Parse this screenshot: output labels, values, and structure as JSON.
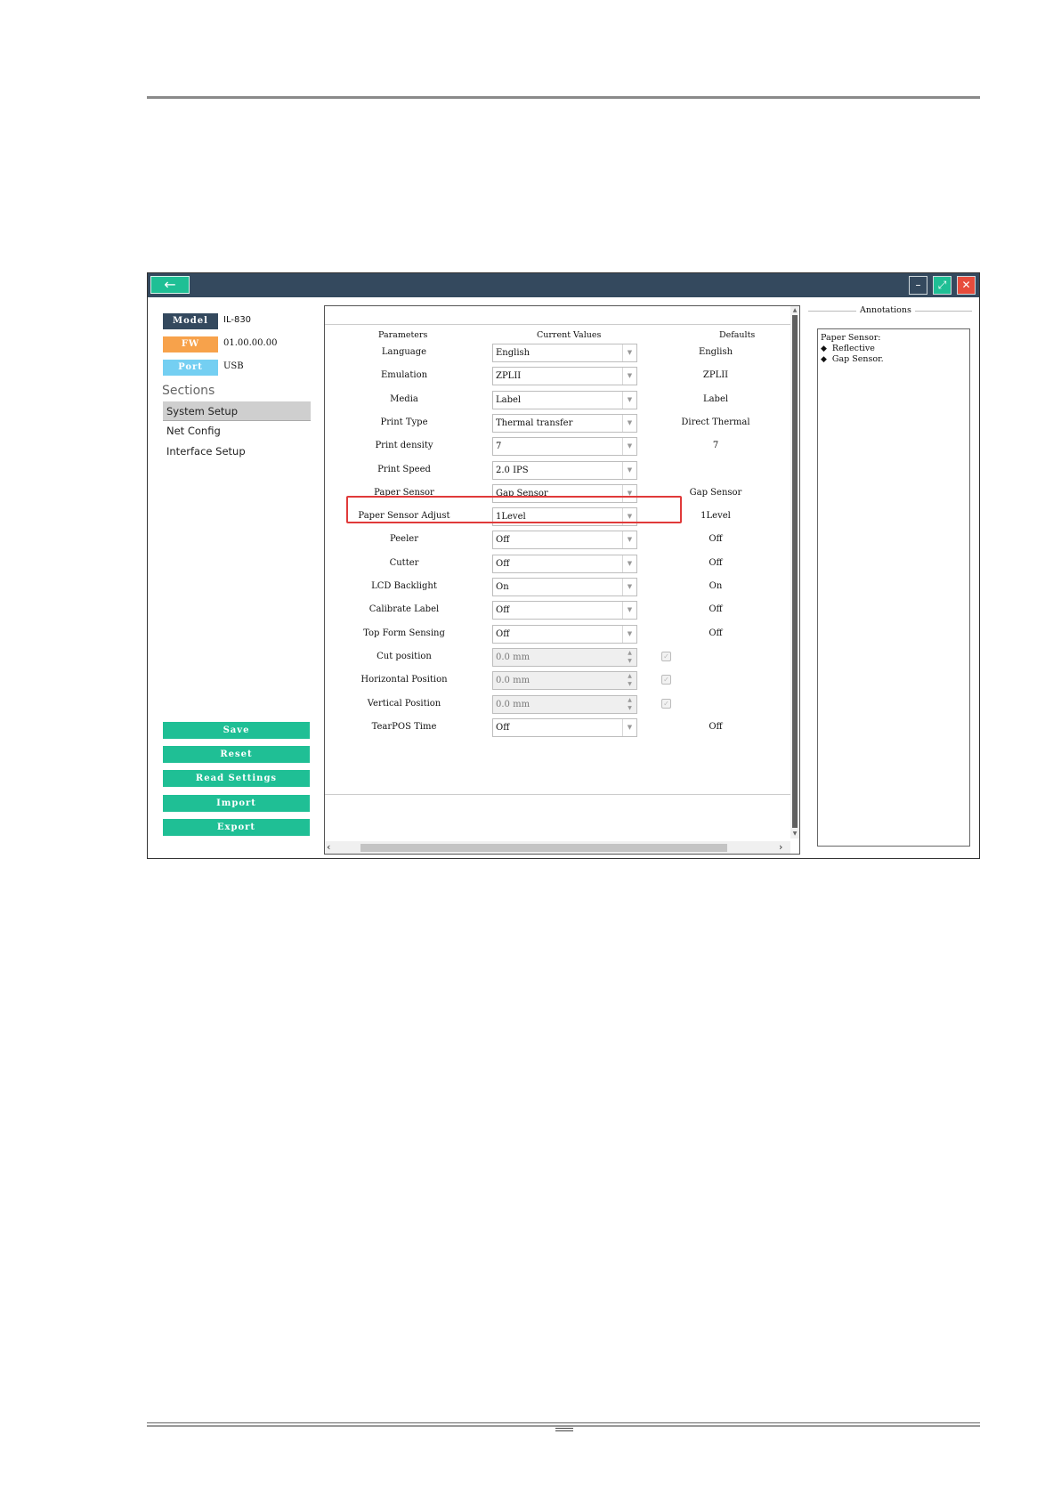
{
  "window": {
    "back_icon": "arrow-left-icon",
    "controls": [
      "minimize-icon",
      "maximize-icon",
      "close-icon"
    ]
  },
  "device": {
    "model_label": "Model",
    "model_value": "IL-830",
    "fw_label": "FW",
    "fw_value": "01.00.00.00",
    "port_label": "Port",
    "port_value": "USB"
  },
  "colors": {
    "titlebar": "#34495e",
    "accent": "#1fbf95",
    "close": "#e74c3c",
    "fw_badge": "#f7a24b",
    "port_badge": "#74cff2",
    "model_badge": "#34495e",
    "highlight": "#e03a3a"
  },
  "sections": {
    "title": "Sections",
    "items": [
      {
        "label": "System Setup",
        "active": true
      },
      {
        "label": "Net Config",
        "active": false
      },
      {
        "label": "Interface Setup",
        "active": false
      }
    ]
  },
  "actions": [
    "Save",
    "Reset",
    "Read Settings",
    "Import",
    "Export"
  ],
  "table": {
    "headers": {
      "parameters": "Parameters",
      "current": "Current Values",
      "defaults": "Defaults"
    },
    "rows": [
      {
        "label": "Language",
        "value": "English",
        "kind": "dropdown",
        "default": "English"
      },
      {
        "label": "Emulation",
        "value": "ZPLII",
        "kind": "dropdown",
        "default": "ZPLII"
      },
      {
        "label": "Media",
        "value": "Label",
        "kind": "dropdown",
        "default": "Label"
      },
      {
        "label": "Print Type",
        "value": "Thermal transfer",
        "kind": "dropdown",
        "default": "Direct Thermal"
      },
      {
        "label": "Print density",
        "value": "7",
        "kind": "dropdown",
        "default": "7"
      },
      {
        "label": "Print Speed",
        "value": "2.0 IPS",
        "kind": "dropdown",
        "default": ""
      },
      {
        "label": "Paper Sensor",
        "value": "Gap Sensor",
        "kind": "dropdown",
        "default": "Gap Sensor"
      },
      {
        "label": "Paper Sensor Adjust",
        "value": "1Level",
        "kind": "dropdown",
        "default": "1Level"
      },
      {
        "label": "Peeler",
        "value": "Off",
        "kind": "dropdown",
        "default": "Off"
      },
      {
        "label": "Cutter",
        "value": "Off",
        "kind": "dropdown",
        "default": "Off"
      },
      {
        "label": "LCD Backlight",
        "value": "On",
        "kind": "dropdown",
        "default": "On"
      },
      {
        "label": "Calibrate Label",
        "value": "Off",
        "kind": "dropdown",
        "default": "Off"
      },
      {
        "label": "Top Form Sensing",
        "value": "Off",
        "kind": "dropdown",
        "default": "Off"
      },
      {
        "label": "Cut position",
        "value": "0.0 mm",
        "kind": "spinner",
        "default": ""
      },
      {
        "label": "Horizontal Position",
        "value": "0.0 mm",
        "kind": "spinner",
        "default": ""
      },
      {
        "label": "Vertical Position",
        "value": "0.0 mm",
        "kind": "spinner",
        "default": ""
      },
      {
        "label": "TearPOS Time",
        "value": "Off",
        "kind": "dropdown",
        "default": "Off"
      }
    ]
  },
  "annotations": {
    "title": "Annotations",
    "heading": "Paper Sensor:",
    "items": [
      "Reflective",
      "Gap Sensor."
    ]
  }
}
